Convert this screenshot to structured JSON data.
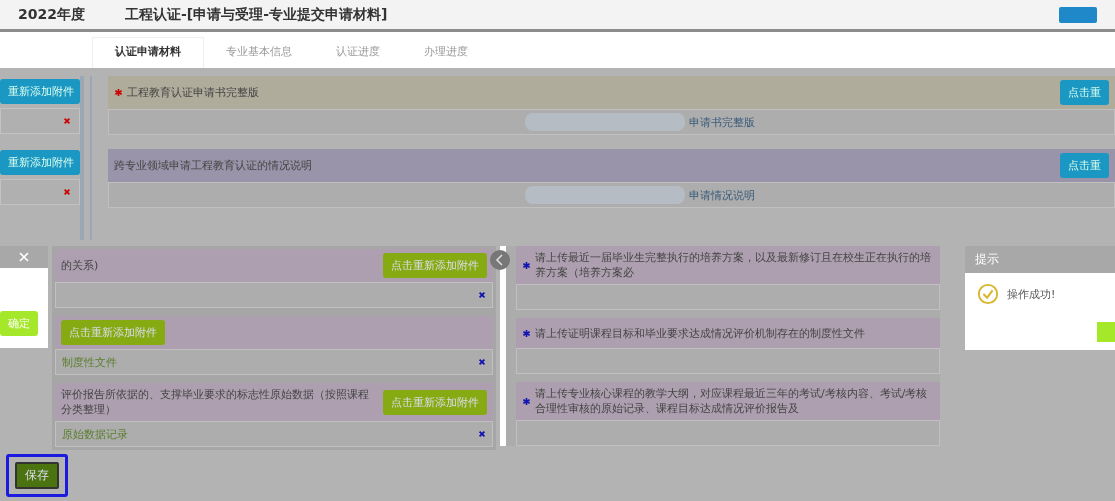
{
  "header": {
    "title_parts": [
      "2022年度",
      "工程认证-[申请与受理-专业提交申请材料]"
    ]
  },
  "tabs": [
    {
      "label": "认证申请材料",
      "selected": true
    },
    {
      "label": "专业基本信息",
      "selected": false
    },
    {
      "label": "认证进度",
      "selected": false
    },
    {
      "label": "办理进度",
      "selected": false
    }
  ],
  "upper": {
    "side_buttons": [
      "重新添加附件",
      "重新添加附件"
    ],
    "items": [
      {
        "required": true,
        "highlighted": true,
        "title": "工程教育认证申请书完整版",
        "button": "点击重",
        "file": "申请书完整版"
      },
      {
        "required": false,
        "highlighted": false,
        "title": "跨专业领域申请工程教育认证的情况说明",
        "button": "点击重",
        "file": "申请情况说明"
      }
    ]
  },
  "left_dialog": {
    "button": "确定"
  },
  "lower_left": [
    {
      "title": "的关系)",
      "button": "点击重新添加附件"
    },
    {
      "button": "点击重新添加附件",
      "file": "制度性文件"
    },
    {
      "title": "评价报告所依据的、支撑毕业要求的标志性原始数据（按照课程分类整理）",
      "button": "点击重新添加附件",
      "file": "原始数据记录"
    }
  ],
  "lower_right": [
    {
      "required": true,
      "title": "请上传最近一届毕业生完整执行的培养方案，以及最新修订且在校生正在执行的培养方案（培养方案必"
    },
    {
      "required": true,
      "title": "请上传证明课程目标和毕业要求达成情况评价机制存在的制度性文件"
    },
    {
      "required": true,
      "title": "请上传专业核心课程的教学大纲，对应课程最近三年的考试/考核内容、考试/考核合理性审核的原始记录、课程目标达成情况评价报告及"
    }
  ],
  "toast": {
    "title": "提示",
    "message": "操作成功!"
  },
  "save_button": "保存"
}
